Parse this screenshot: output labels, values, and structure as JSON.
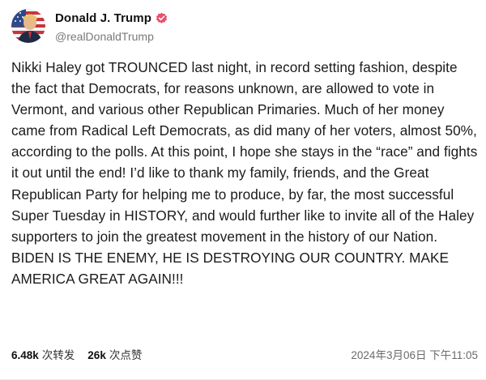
{
  "post": {
    "author": {
      "display_name": "Donald J. Trump",
      "handle": "@realDonaldTrump",
      "verified_color": "#e8506a"
    },
    "text": "Nikki Haley got TROUNCED last night, in record setting fashion, despite the fact that Democrats, for reasons unknown, are allowed to vote in Vermont, and various other Republican Primaries. Much of her money came from Radical Left Democrats, as did many of her voters, almost 50%, according to the polls. At this point, I hope she stays in the “race” and fights it out until the end! I’d like to thank my family, friends, and the Great Republican Party for helping me to produce, by far, the most successful Super Tuesday in HISTORY, and would further like to invite all of the Haley supporters to join the greatest movement in the history of our Nation. BIDEN IS THE ENEMY, HE IS DESTROYING OUR COUNTRY. MAKE AMERICA GREAT AGAIN!!!",
    "stats": {
      "reposts_count": "6.48k",
      "reposts_label": "次转发",
      "likes_count": "26k",
      "likes_label": "次点赞"
    },
    "timestamp": "2024年3月06日 下午11:05"
  },
  "icons": {
    "avatar": "avatar-flag-portrait",
    "verified": "verified-badge-icon"
  }
}
